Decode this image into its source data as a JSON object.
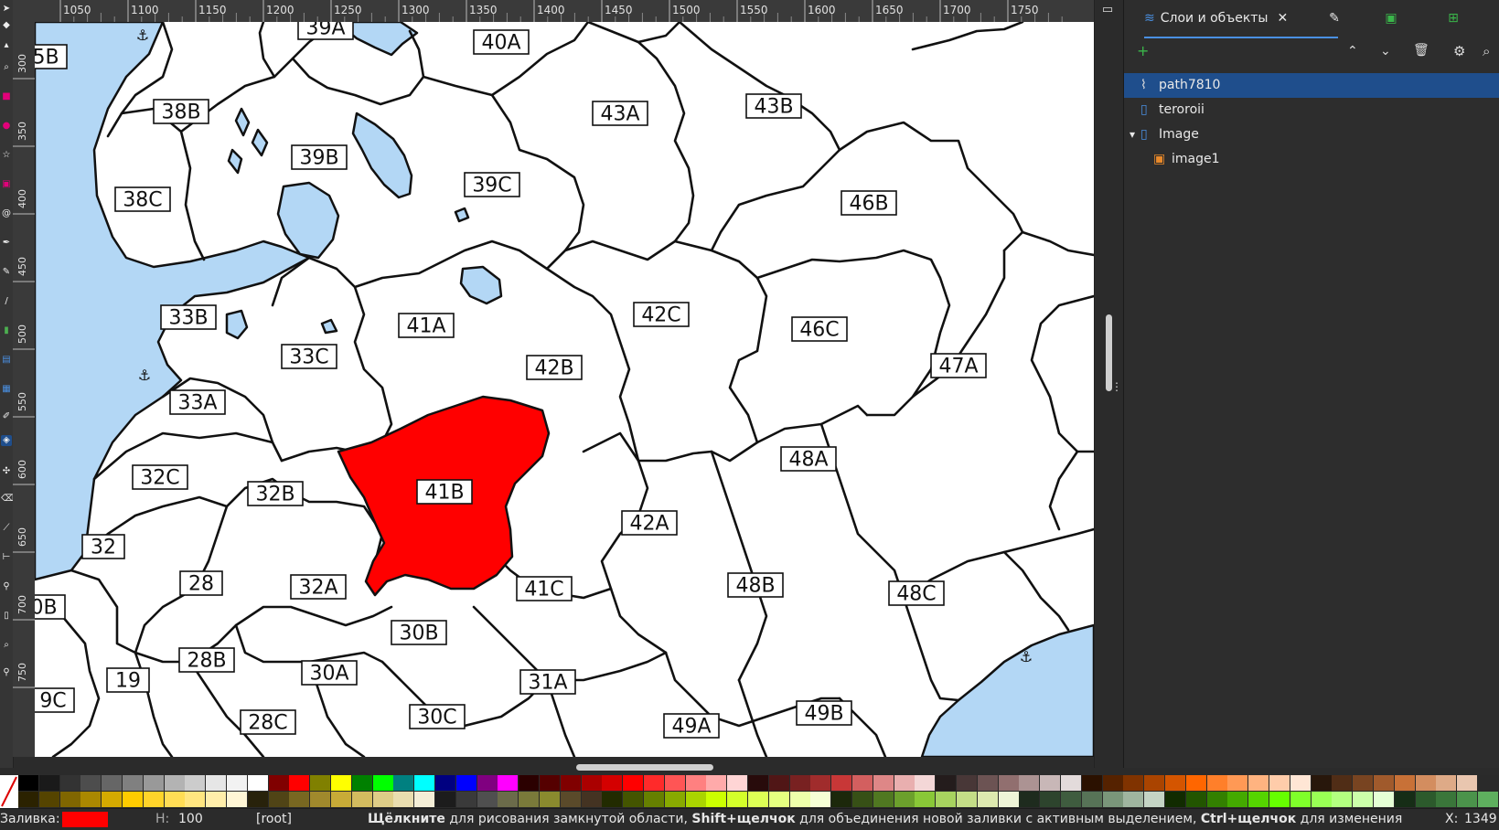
{
  "app": {
    "colors": {
      "selection": "#1f4e8c",
      "fill_red": "#ff0000",
      "water": "#b3d7f5"
    }
  },
  "ruler": {
    "top_ticks": [
      "1050",
      "1100",
      "1150",
      "1200",
      "1250",
      "1300",
      "1350",
      "1400",
      "1450",
      "1500",
      "1550",
      "1600",
      "1650",
      "1700",
      "1750"
    ],
    "left_ticks": [
      "300",
      "350",
      "400",
      "450",
      "500",
      "550",
      "600",
      "650",
      "700",
      "750"
    ]
  },
  "panel": {
    "tab_layers": "Слои и объекты",
    "tree": [
      {
        "label": "path7810",
        "icon": "path-icon",
        "selected": true,
        "indent": 0
      },
      {
        "label": "teroroii",
        "icon": "layer-icon",
        "selected": false,
        "indent": 0
      },
      {
        "label": "Image",
        "icon": "layer-icon",
        "selected": false,
        "indent": 0,
        "expanded": true
      },
      {
        "label": "image1",
        "icon": "image-icon",
        "selected": false,
        "indent": 1
      }
    ]
  },
  "map": {
    "regions": [
      {
        "label": "40A"
      },
      {
        "label": "39A"
      },
      {
        "label": "5B"
      },
      {
        "label": "43A"
      },
      {
        "label": "43B"
      },
      {
        "label": "38B"
      },
      {
        "label": "39B"
      },
      {
        "label": "39C"
      },
      {
        "label": "38C"
      },
      {
        "label": "46B"
      },
      {
        "label": "33B"
      },
      {
        "label": "41A"
      },
      {
        "label": "42C"
      },
      {
        "label": "33C"
      },
      {
        "label": "42B"
      },
      {
        "label": "46C"
      },
      {
        "label": "47A"
      },
      {
        "label": "33A"
      },
      {
        "label": "48A"
      },
      {
        "label": "32C"
      },
      {
        "label": "32B"
      },
      {
        "label": "41B"
      },
      {
        "label": "42A"
      },
      {
        "label": "32"
      },
      {
        "label": "28"
      },
      {
        "label": "32A"
      },
      {
        "label": "41C"
      },
      {
        "label": "48B"
      },
      {
        "label": "48C"
      },
      {
        "label": "0B"
      },
      {
        "label": "30B"
      },
      {
        "label": "28B"
      },
      {
        "label": "19"
      },
      {
        "label": "30A"
      },
      {
        "label": "31A"
      },
      {
        "label": "9C"
      },
      {
        "label": "28C"
      },
      {
        "label": "30C"
      },
      {
        "label": "49A"
      },
      {
        "label": "49B"
      }
    ]
  },
  "status": {
    "fill_label": "Заливка:",
    "opacity_value": "100",
    "layer_value": "[root]",
    "hint": [
      {
        "text": "Щёлкните",
        "bold": true
      },
      {
        "text": " для рисования замкнутой области, ",
        "bold": false
      },
      {
        "text": "Shift+щелчок",
        "bold": true
      },
      {
        "text": " для объединения новой заливки с активным выделением, ",
        "bold": false
      },
      {
        "text": "Ctrl+щелчок",
        "bold": true
      },
      {
        "text": " для изменения",
        "bold": false
      }
    ],
    "coord_label": "X:",
    "coord_value": "1349"
  },
  "palette": {
    "row1": [
      "#000000",
      "#1a1a1a",
      "#333333",
      "#4d4d4d",
      "#666666",
      "#808080",
      "#999999",
      "#b3b3b3",
      "#cccccc",
      "#e6e6e6",
      "#f2f2f2",
      "#ffffff",
      "#800000",
      "#ff0000",
      "#808000",
      "#ffff00",
      "#008000",
      "#00ff00",
      "#008080",
      "#00ffff",
      "#000080",
      "#0000ff",
      "#800080",
      "#ff00ff",
      "#2b0000",
      "#550000",
      "#800000",
      "#aa0000",
      "#d40000",
      "#ff0000",
      "#ff2a2a",
      "#ff5555",
      "#ff8080",
      "#ffaaaa",
      "#ffd5d5",
      "#280b0b",
      "#501616",
      "#782121",
      "#a02c2c",
      "#c83737",
      "#d35f5f",
      "#de8787",
      "#e9afaf",
      "#f4d7d7",
      "#241c1c",
      "#483737",
      "#6c5353",
      "#916f6f",
      "#ac9393",
      "#c8b7b7",
      "#e3dbdb",
      "#2b1100",
      "#552200",
      "#803300",
      "#aa4400",
      "#d45500",
      "#ff6600",
      "#ff7f2a",
      "#ff9955",
      "#ffb380",
      "#ffccaa",
      "#ffe6d5",
      "#28170b",
      "#502d16",
      "#784421",
      "#a05a2c",
      "#c87137",
      "#d38d5f",
      "#deaa87",
      "#e9c6af"
    ],
    "row2": [
      "#2b2200",
      "#554400",
      "#806600",
      "#aa8800",
      "#d4aa00",
      "#ffcc00",
      "#ffd42a",
      "#ffdd55",
      "#ffe680",
      "#ffeeaa",
      "#fff6d5",
      "#28220b",
      "#504416",
      "#786721",
      "#a0892c",
      "#c8ab37",
      "#d3bc5f",
      "#decd87",
      "#e9ddaf",
      "#f4eed7",
      "#1c1c1c",
      "#3a3a3a",
      "#4f4f4f",
      "#6b6b4a",
      "#7a7a3a",
      "#8a8a2e",
      "#5a4a2a",
      "#443322",
      "#222b00",
      "#445500",
      "#668000",
      "#88aa00",
      "#aad400",
      "#ccff00",
      "#d4ff2a",
      "#ddff55",
      "#e5ff80",
      "#eeffaa",
      "#f6ffd5",
      "#1c280b",
      "#375016",
      "#507821",
      "#6ca02c",
      "#89c837",
      "#a7d35f",
      "#c4de87",
      "#dde9af",
      "#eef4d7",
      "#1e2b1e",
      "#2d442d",
      "#3f5c3f",
      "#577357",
      "#7a967a",
      "#9fb59f",
      "#c4d4c4",
      "#112b00",
      "#225500",
      "#338000",
      "#44aa00",
      "#55d400",
      "#66ff00",
      "#7fff2a",
      "#99ff55",
      "#b3ff80",
      "#ccffaa",
      "#e5ffd5",
      "#162d16",
      "#2c5a2c",
      "#3a763a",
      "#4b934b",
      "#5eaf5e",
      "#7ec37e"
    ]
  }
}
